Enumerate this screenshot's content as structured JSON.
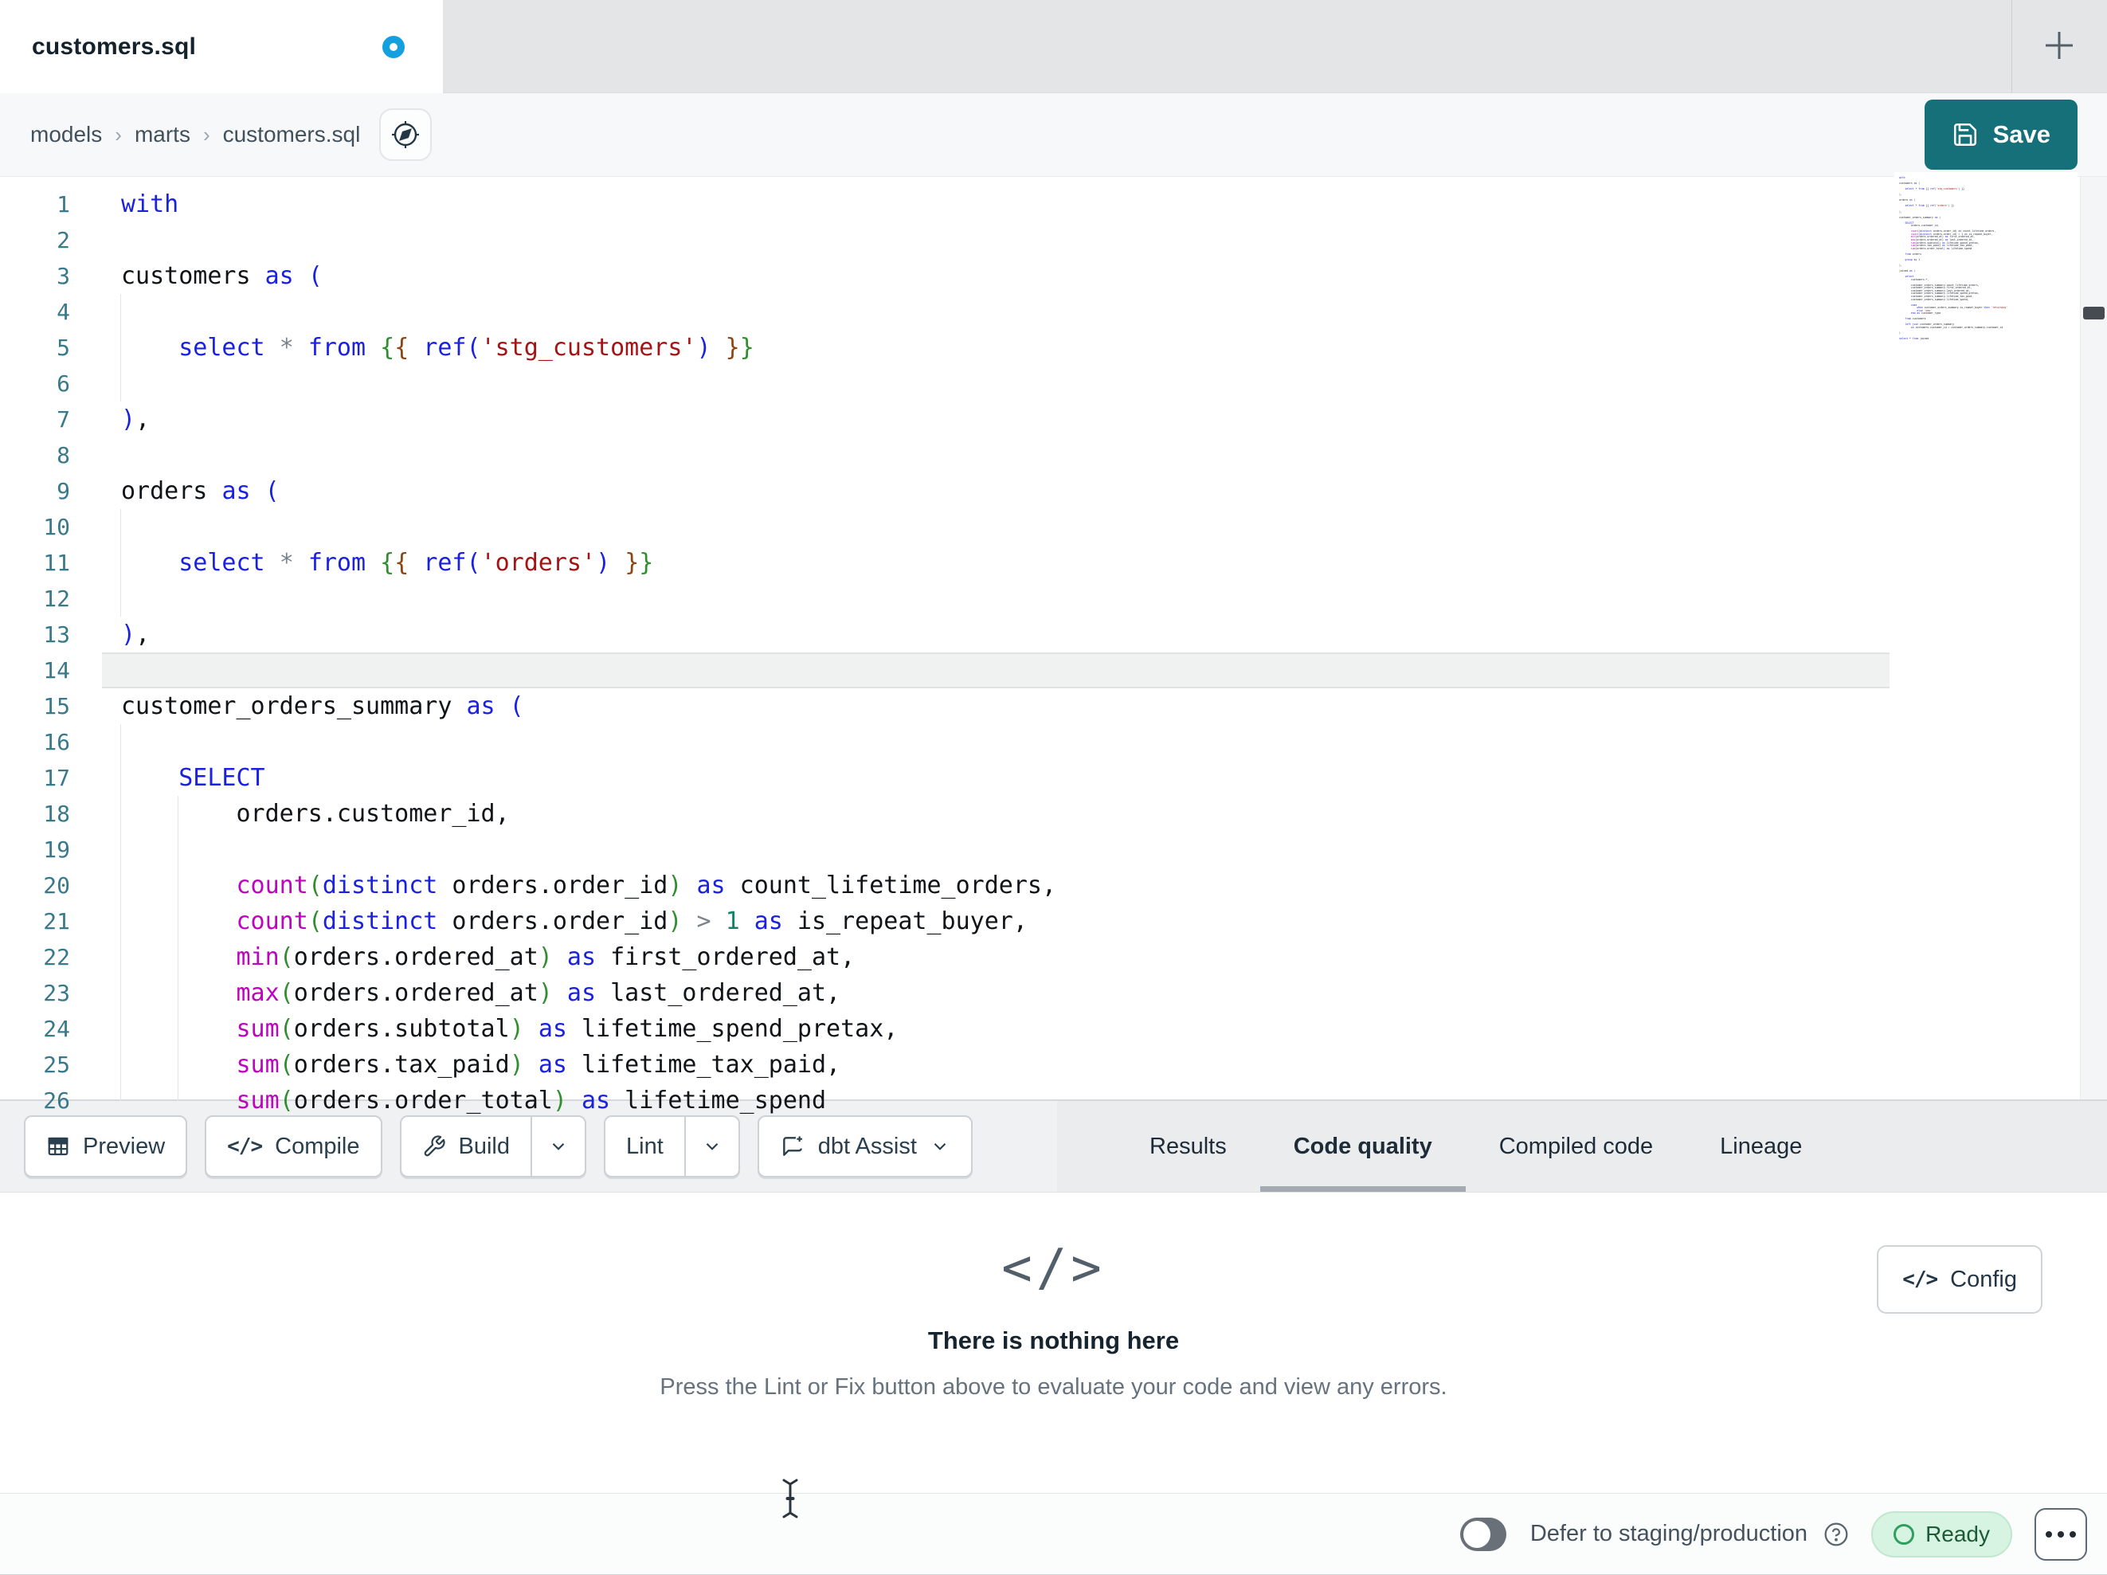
{
  "window": {
    "tab_title": "customers.sql",
    "modified": true
  },
  "breadcrumb": {
    "items": [
      "models",
      "marts",
      "customers.sql"
    ],
    "separator": "›"
  },
  "actions": {
    "save_label": "Save"
  },
  "editor": {
    "language": "sql",
    "lines": [
      {
        "n": 1,
        "g": 0,
        "t": [
          [
            "k",
            "with"
          ]
        ]
      },
      {
        "n": 2,
        "g": 0,
        "t": []
      },
      {
        "n": 3,
        "g": 0,
        "t": [
          [
            "p",
            "customers "
          ],
          [
            "k",
            "as"
          ],
          [
            "p",
            " "
          ],
          [
            "b1",
            "("
          ]
        ]
      },
      {
        "n": 4,
        "g": 1,
        "t": []
      },
      {
        "n": 5,
        "g": 1,
        "t": [
          [
            "p",
            "    "
          ],
          [
            "k",
            "select"
          ],
          [
            "p",
            " "
          ],
          [
            "o",
            "*"
          ],
          [
            "p",
            " "
          ],
          [
            "k",
            "from"
          ],
          [
            "p",
            " "
          ],
          [
            "b2",
            "{"
          ],
          [
            "b3",
            "{"
          ],
          [
            "p",
            " "
          ],
          [
            "k",
            "ref"
          ],
          [
            "b1",
            "("
          ],
          [
            "s",
            "'stg_customers'"
          ],
          [
            "b1",
            ")"
          ],
          [
            "p",
            " "
          ],
          [
            "b3",
            "}"
          ],
          [
            "b2",
            "}"
          ]
        ]
      },
      {
        "n": 6,
        "g": 1,
        "t": []
      },
      {
        "n": 7,
        "g": 0,
        "t": [
          [
            "b1",
            ")"
          ],
          [
            "p",
            ","
          ]
        ]
      },
      {
        "n": 8,
        "g": 0,
        "t": []
      },
      {
        "n": 9,
        "g": 0,
        "t": [
          [
            "p",
            "orders "
          ],
          [
            "k",
            "as"
          ],
          [
            "p",
            " "
          ],
          [
            "b1",
            "("
          ]
        ]
      },
      {
        "n": 10,
        "g": 1,
        "t": []
      },
      {
        "n": 11,
        "g": 1,
        "t": [
          [
            "p",
            "    "
          ],
          [
            "k",
            "select"
          ],
          [
            "p",
            " "
          ],
          [
            "o",
            "*"
          ],
          [
            "p",
            " "
          ],
          [
            "k",
            "from"
          ],
          [
            "p",
            " "
          ],
          [
            "b2",
            "{"
          ],
          [
            "b3",
            "{"
          ],
          [
            "p",
            " "
          ],
          [
            "k",
            "ref"
          ],
          [
            "b1",
            "("
          ],
          [
            "s",
            "'orders'"
          ],
          [
            "b1",
            ")"
          ],
          [
            "p",
            " "
          ],
          [
            "b3",
            "}"
          ],
          [
            "b2",
            "}"
          ]
        ]
      },
      {
        "n": 12,
        "g": 1,
        "t": []
      },
      {
        "n": 13,
        "g": 0,
        "t": [
          [
            "b1",
            ")"
          ],
          [
            "p",
            ","
          ]
        ]
      },
      {
        "n": 14,
        "g": 0,
        "hl": true,
        "t": []
      },
      {
        "n": 15,
        "g": 0,
        "t": [
          [
            "p",
            "customer_orders_summary "
          ],
          [
            "k",
            "as"
          ],
          [
            "p",
            " "
          ],
          [
            "b1",
            "("
          ]
        ]
      },
      {
        "n": 16,
        "g": 1,
        "t": []
      },
      {
        "n": 17,
        "g": 1,
        "t": [
          [
            "p",
            "    "
          ],
          [
            "k",
            "SELECT"
          ]
        ]
      },
      {
        "n": 18,
        "g": 2,
        "t": [
          [
            "p",
            "        orders.customer_id,"
          ]
        ]
      },
      {
        "n": 19,
        "g": 2,
        "t": []
      },
      {
        "n": 20,
        "g": 2,
        "t": [
          [
            "p",
            "        "
          ],
          [
            "f",
            "count"
          ],
          [
            "b2",
            "("
          ],
          [
            "k",
            "distinct"
          ],
          [
            "p",
            " orders.order_id"
          ],
          [
            "b2",
            ")"
          ],
          [
            "p",
            " "
          ],
          [
            "k",
            "as"
          ],
          [
            "p",
            " count_lifetime_orders,"
          ]
        ]
      },
      {
        "n": 21,
        "g": 2,
        "t": [
          [
            "p",
            "        "
          ],
          [
            "f",
            "count"
          ],
          [
            "b2",
            "("
          ],
          [
            "k",
            "distinct"
          ],
          [
            "p",
            " orders.order_id"
          ],
          [
            "b2",
            ")"
          ],
          [
            "p",
            " "
          ],
          [
            "o",
            ">"
          ],
          [
            "p",
            " "
          ],
          [
            "n",
            "1"
          ],
          [
            "p",
            " "
          ],
          [
            "k",
            "as"
          ],
          [
            "p",
            " is_repeat_buyer,"
          ]
        ]
      },
      {
        "n": 22,
        "g": 2,
        "t": [
          [
            "p",
            "        "
          ],
          [
            "f",
            "min"
          ],
          [
            "b2",
            "("
          ],
          [
            "p",
            "orders.ordered_at"
          ],
          [
            "b2",
            ")"
          ],
          [
            "p",
            " "
          ],
          [
            "k",
            "as"
          ],
          [
            "p",
            " first_ordered_at,"
          ]
        ]
      },
      {
        "n": 23,
        "g": 2,
        "t": [
          [
            "p",
            "        "
          ],
          [
            "f",
            "max"
          ],
          [
            "b2",
            "("
          ],
          [
            "p",
            "orders.ordered_at"
          ],
          [
            "b2",
            ")"
          ],
          [
            "p",
            " "
          ],
          [
            "k",
            "as"
          ],
          [
            "p",
            " last_ordered_at,"
          ]
        ]
      },
      {
        "n": 24,
        "g": 2,
        "t": [
          [
            "p",
            "        "
          ],
          [
            "f",
            "sum"
          ],
          [
            "b2",
            "("
          ],
          [
            "p",
            "orders.subtotal"
          ],
          [
            "b2",
            ")"
          ],
          [
            "p",
            " "
          ],
          [
            "k",
            "as"
          ],
          [
            "p",
            " lifetime_spend_pretax,"
          ]
        ]
      },
      {
        "n": 25,
        "g": 2,
        "t": [
          [
            "p",
            "        "
          ],
          [
            "f",
            "sum"
          ],
          [
            "b2",
            "("
          ],
          [
            "p",
            "orders.tax_paid"
          ],
          [
            "b2",
            ")"
          ],
          [
            "p",
            " "
          ],
          [
            "k",
            "as"
          ],
          [
            "p",
            " lifetime_tax_paid,"
          ]
        ]
      },
      {
        "n": 26,
        "g": 2,
        "t": [
          [
            "p",
            "        "
          ],
          [
            "f",
            "sum"
          ],
          [
            "b2",
            "("
          ],
          [
            "p",
            "orders.order_total"
          ],
          [
            "b2",
            ")"
          ],
          [
            "p",
            " "
          ],
          [
            "k",
            "as"
          ],
          [
            "p",
            " lifetime_spend"
          ]
        ]
      }
    ],
    "minimap_text": "with\n\ncustomers as (\n\n    select * from {{ ref('stg_customers') }}\n\n),\n\norders as (\n\n    select * from {{ ref('orders') }}\n\n),\n\ncustomer_orders_summary as (\n\n    SELECT\n        orders.customer_id,\n\n        count(distinct orders.order_id) as count_lifetime_orders,\n        count(distinct orders.order_id) > 1 as is_repeat_buyer,\n        min(orders.ordered_at) as first_ordered_at,\n        max(orders.ordered_at) as last_ordered_at,\n        sum(orders.subtotal) as lifetime_spend_pretax,\n        sum(orders.tax_paid) as lifetime_tax_paid,\n        sum(orders.order_total) as lifetime_spend\n\n    from orders\n\n    group by 1\n\n),\n\njoined as (\n\n    select\n        customers.*,\n\n        customer_orders_summary.count_lifetime_orders,\n        customer_orders_summary.first_ordered_at,\n        customer_orders_summary.last_ordered_at,\n        customer_orders_summary.lifetime_spend_pretax,\n        customer_orders_summary.lifetime_tax_paid,\n        customer_orders_summary.lifetime_spend,\n\n        case\n            when customer_orders_summary.is_repeat_buyer then 'returning'\n            else 'new'\n        end as customer_type\n\n    from customers\n\n    left join customer_orders_summary\n        on customers.customer_id = customer_orders_summary.customer_id\n\n)\n\nselect * from joined"
  },
  "toolbar": {
    "preview": "Preview",
    "compile": "Compile",
    "build": "Build",
    "lint": "Lint",
    "assist": "dbt Assist"
  },
  "panel_tabs": [
    {
      "label": "Results",
      "active": false
    },
    {
      "label": "Code quality",
      "active": true
    },
    {
      "label": "Compiled code",
      "active": false
    },
    {
      "label": "Lineage",
      "active": false
    }
  ],
  "results_panel": {
    "empty_icon": "</>",
    "title": "There is nothing here",
    "subtitle": "Press the Lint or Fix button above to evaluate your code and view any errors.",
    "config_label": "Config",
    "config_icon": "</>"
  },
  "statusbar": {
    "defer_label": "Defer to staging/production",
    "defer_toggle_on": false,
    "ready_label": "Ready"
  },
  "colors": {
    "save_teal": "#15707a",
    "modified_dot_blue": "#149fdf",
    "ready_bg": "#d7f3e1",
    "ready_text": "#1d5b36",
    "keyword_blue": "#1a21e0",
    "function_magenta": "#bc05bc",
    "string_red": "#a31515",
    "line_number_teal": "#38798b",
    "active_tab_underline": "#a4aab2"
  }
}
